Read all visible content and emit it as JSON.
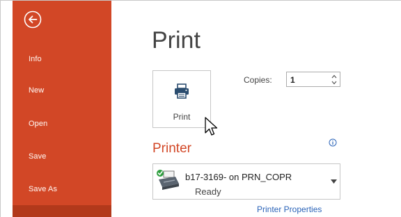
{
  "sidebar": {
    "accent_color": "#d24726",
    "selected_color": "#b2391b",
    "back_icon": "arrow-left-circle-icon",
    "items": [
      {
        "label": "Info"
      },
      {
        "label": "New"
      },
      {
        "label": "Open"
      },
      {
        "label": "Save"
      },
      {
        "label": "Save As"
      }
    ]
  },
  "main": {
    "title": "Print",
    "print_button": {
      "label": "Print",
      "icon": "printer-icon"
    },
    "copies": {
      "label": "Copies:",
      "value": "1"
    },
    "printer_section": {
      "heading": "Printer",
      "info_icon": "info-icon",
      "selected_printer": {
        "name": "b17-3169- on PRN_COPR",
        "status": "Ready",
        "icon": "printer-ready-icon"
      },
      "properties_link": "Printer Properties"
    }
  },
  "colors": {
    "heading_accent": "#d24726",
    "link": "#2a63b8",
    "text": "#444444"
  }
}
